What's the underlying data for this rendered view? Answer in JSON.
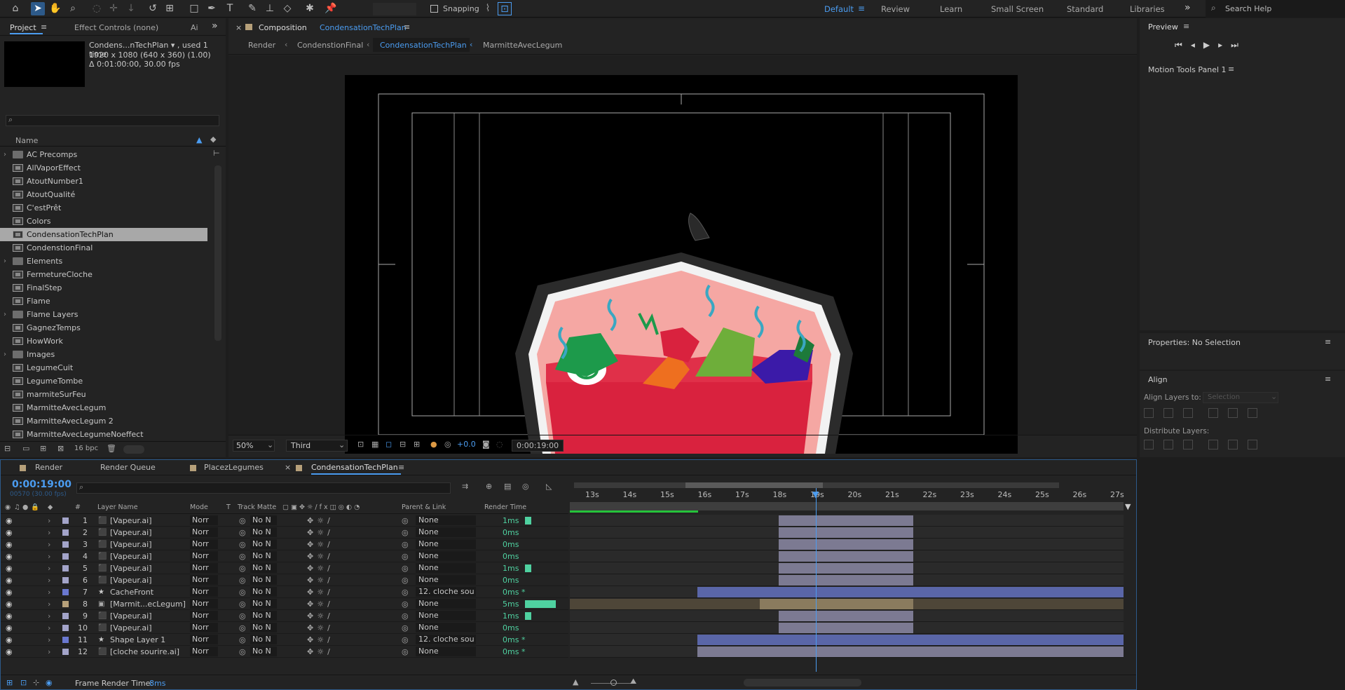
{
  "toolbar": {
    "snapping_label": "Snapping",
    "workspaces": [
      "Default",
      "Review",
      "Learn",
      "Small Screen",
      "Standard",
      "Libraries"
    ],
    "active_workspace": "Default",
    "search_placeholder": "Search Help"
  },
  "project": {
    "tab_project": "Project",
    "tab_effect_controls": "Effect Controls (none)",
    "tab_more": "Ai",
    "selected_name": "Condens...nTechPlan ▾ , used 1 time",
    "selected_size": "1920 x 1080  (640 x 360) (1.00)",
    "selected_duration": "Δ 0:01:00:00, 30.00 fps",
    "column_name": "Name",
    "bpc_label": "16 bpc",
    "items": [
      {
        "name": "AC Precomps",
        "type": "folder"
      },
      {
        "name": "AllVaporEffect",
        "type": "comp"
      },
      {
        "name": "AtoutNumber1",
        "type": "comp"
      },
      {
        "name": "AtoutQualité",
        "type": "comp"
      },
      {
        "name": "C'estPrêt",
        "type": "comp"
      },
      {
        "name": "Colors",
        "type": "comp"
      },
      {
        "name": "CondensationTechPlan",
        "type": "comp",
        "selected": true
      },
      {
        "name": "CondenstionFinal",
        "type": "comp"
      },
      {
        "name": "Elements",
        "type": "folder"
      },
      {
        "name": "FermetureCloche",
        "type": "comp"
      },
      {
        "name": "FinalStep",
        "type": "comp"
      },
      {
        "name": "Flame",
        "type": "comp"
      },
      {
        "name": "Flame Layers",
        "type": "folder"
      },
      {
        "name": "GagnezTemps",
        "type": "comp"
      },
      {
        "name": "HowWork",
        "type": "comp"
      },
      {
        "name": "Images",
        "type": "folder"
      },
      {
        "name": "LegumeCuit",
        "type": "comp"
      },
      {
        "name": "LegumeTombe",
        "type": "comp"
      },
      {
        "name": "marmiteSurFeu",
        "type": "comp"
      },
      {
        "name": "MarmitteAvecLegum",
        "type": "comp"
      },
      {
        "name": "MarmitteAvecLegum 2",
        "type": "comp"
      },
      {
        "name": "MarmitteAvecLegumeNoeffect",
        "type": "comp"
      }
    ]
  },
  "composition": {
    "panel_label": "Composition",
    "comp_name": "CondensationTechPlan",
    "breadcrumbs": [
      "Render",
      "CondenstionFinal",
      "CondensationTechPlan",
      "MarmitteAvecLegum"
    ],
    "active_breadcrumb": "CondensationTechPlan",
    "zoom": "50%",
    "resolution": "Third",
    "exposure": "+0.0",
    "timecode": "0:00:19:00"
  },
  "preview": {
    "title": "Preview"
  },
  "motion_tools": {
    "title": "Motion Tools Panel 1"
  },
  "properties": {
    "title": "Properties: No Selection"
  },
  "align": {
    "title": "Align",
    "align_layers_to": "Align Layers to:",
    "align_target": "Selection",
    "distribute_layers": "Distribute Layers:"
  },
  "timeline": {
    "tabs": [
      "Render",
      "Render Queue",
      "PlacezLegumes",
      "CondensationTechPlan"
    ],
    "active_tab": "CondensationTechPlan",
    "timecode": "0:00:19:00",
    "frame_info": "00570 (30.00 fps)",
    "columns": {
      "layer_name": "Layer Name",
      "mode": "Mode",
      "t": "T",
      "track_matte": "Track Matte",
      "parent": "Parent & Link",
      "render_time": "Render Time"
    },
    "ruler": [
      "13s",
      "14s",
      "15s",
      "16s",
      "17s",
      "18s",
      "19s",
      "20s",
      "21s",
      "22s",
      "23s",
      "24s",
      "25s",
      "26s",
      "27s"
    ],
    "current_time_seconds": 19,
    "layers": [
      {
        "num": "1",
        "name": "[Vapeur.ai]",
        "mode": "Norr",
        "matte": "No N",
        "parent": "None",
        "render": "1ms",
        "render_frac": 0.2,
        "color": "#a3a4c9",
        "icon": "ai",
        "start": 18.0,
        "end": 21.6
      },
      {
        "num": "2",
        "name": "[Vapeur.ai]",
        "mode": "Norr",
        "matte": "No N",
        "parent": "None",
        "render": "0ms",
        "render_frac": 0,
        "color": "#a3a4c9",
        "icon": "ai",
        "start": 18.0,
        "end": 21.6
      },
      {
        "num": "3",
        "name": "[Vapeur.ai]",
        "mode": "Norr",
        "matte": "No N",
        "parent": "None",
        "render": "0ms",
        "render_frac": 0,
        "color": "#a3a4c9",
        "icon": "ai",
        "start": 18.0,
        "end": 21.6
      },
      {
        "num": "4",
        "name": "[Vapeur.ai]",
        "mode": "Norr",
        "matte": "No N",
        "parent": "None",
        "render": "0ms",
        "render_frac": 0,
        "color": "#a3a4c9",
        "icon": "ai",
        "start": 18.0,
        "end": 21.6
      },
      {
        "num": "5",
        "name": "[Vapeur.ai]",
        "mode": "Norr",
        "matte": "No N",
        "parent": "None",
        "render": "1ms",
        "render_frac": 0.2,
        "color": "#a3a4c9",
        "icon": "ai",
        "start": 18.0,
        "end": 21.6
      },
      {
        "num": "6",
        "name": "[Vapeur.ai]",
        "mode": "Norr",
        "matte": "No N",
        "parent": "None",
        "render": "0ms",
        "render_frac": 0,
        "color": "#a3a4c9",
        "icon": "ai",
        "start": 18.0,
        "end": 21.6
      },
      {
        "num": "7",
        "name": "CacheFront",
        "mode": "Norr",
        "matte": "No N",
        "parent": "12. cloche sou",
        "render": "0ms *",
        "render_frac": 0,
        "color": "#6a78d0",
        "icon": "star",
        "start": 15.85,
        "end": 27.2
      },
      {
        "num": "8",
        "name": "[Marmit...ecLegum]",
        "mode": "Norr",
        "matte": "No N",
        "parent": "None",
        "render": "5ms",
        "render_frac": 1,
        "color": "#b6a07a",
        "icon": "comp",
        "start": 17.5,
        "end": 21.6,
        "pre": 12.0
      },
      {
        "num": "9",
        "name": "[Vapeur.ai]",
        "mode": "Norr",
        "matte": "No N",
        "parent": "None",
        "render": "1ms",
        "render_frac": 0.2,
        "color": "#a3a4c9",
        "icon": "ai",
        "start": 18.0,
        "end": 21.6
      },
      {
        "num": "10",
        "name": "[Vapeur.ai]",
        "mode": "Norr",
        "matte": "No N",
        "parent": "None",
        "render": "0ms",
        "render_frac": 0,
        "color": "#a3a4c9",
        "icon": "ai",
        "start": 18.0,
        "end": 21.6
      },
      {
        "num": "11",
        "name": "Shape Layer 1",
        "mode": "Norr",
        "matte": "No N",
        "parent": "12. cloche sou",
        "render": "0ms *",
        "render_frac": 0,
        "color": "#6a78d0",
        "icon": "star",
        "start": 15.85,
        "end": 27.2
      },
      {
        "num": "12",
        "name": "[cloche sourire.ai]",
        "mode": "Norr",
        "matte": "No N",
        "parent": "None",
        "render": "0ms *",
        "render_frac": 0,
        "color": "#a3a4c9",
        "icon": "ai",
        "start": 15.85,
        "end": 27.2
      }
    ],
    "frame_render_label": "Frame Render Time:",
    "frame_render_value": "8ms"
  }
}
